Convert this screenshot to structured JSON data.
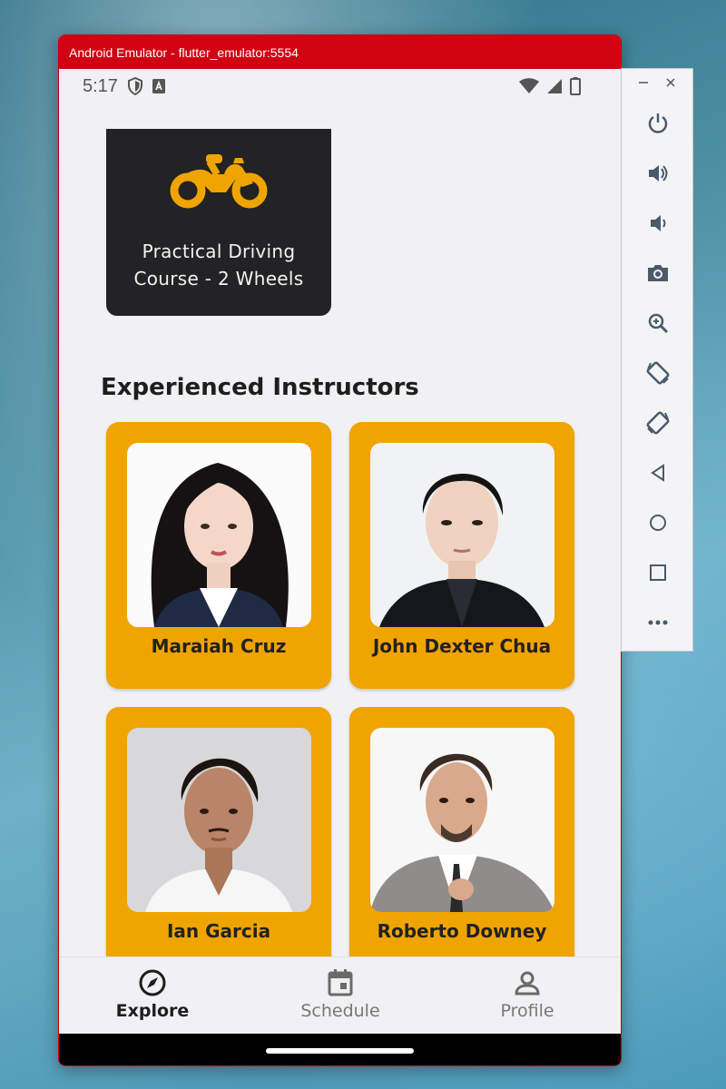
{
  "window": {
    "title": "Android Emulator - flutter_emulator:5554"
  },
  "status_bar": {
    "time": "5:17",
    "icons": [
      "shield-icon",
      "keyboard-a-icon",
      "wifi-icon",
      "signal-icon",
      "battery-icon"
    ]
  },
  "course": {
    "title": "Practical Driving\nCourse - 2 Wheels",
    "icon": "motorcycle-icon",
    "accent": "#f0a400"
  },
  "section": {
    "title": "Experienced Instructors"
  },
  "instructors": [
    {
      "name": "Maraiah Cruz"
    },
    {
      "name": "John Dexter Chua"
    },
    {
      "name": "Ian Garcia"
    },
    {
      "name": "Roberto Downey"
    }
  ],
  "bottom_nav": {
    "items": [
      {
        "label": "Explore",
        "icon": "compass-icon",
        "active": true
      },
      {
        "label": "Schedule",
        "icon": "calendar-icon",
        "active": false
      },
      {
        "label": "Profile",
        "icon": "person-icon",
        "active": false
      }
    ]
  },
  "emulator_toolbar": {
    "buttons": [
      "power-icon",
      "volume-up-icon",
      "volume-down-icon",
      "camera-icon",
      "zoom-icon",
      "rotate-left-icon",
      "rotate-right-icon",
      "back-icon",
      "home-icon",
      "overview-icon",
      "more-icon"
    ]
  },
  "colors": {
    "titlebar": "#d10212",
    "card_accent": "#f0a400",
    "course_card": "#232224"
  }
}
